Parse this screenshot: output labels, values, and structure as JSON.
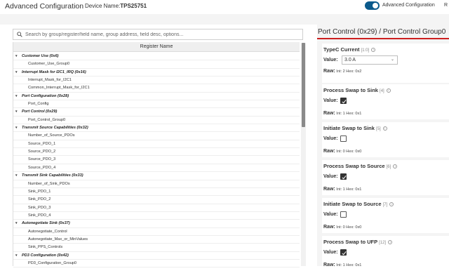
{
  "header": {
    "title": "Advanced Configuration",
    "device_label": "Device Name:",
    "device_name": "TPS25751",
    "toggle_label": "Advanced Configuration",
    "cut_text": "R"
  },
  "search": {
    "placeholder": "Search by group/register/field name, group address, field desc, options..."
  },
  "tree": {
    "header": "Register Name",
    "rows": [
      {
        "type": "group",
        "label": "Customer Use (0x6)"
      },
      {
        "type": "item",
        "label": "Customer_Use_Group0"
      },
      {
        "type": "group",
        "label": "Interrupt Mask for I2C1_IRQ (0x16)"
      },
      {
        "type": "item",
        "label": "Interrupt_Mask_for_I2C1"
      },
      {
        "type": "item",
        "label": "Common_Interrupt_Mask_for_I2C1"
      },
      {
        "type": "group",
        "label": "Port Configuration (0x28)"
      },
      {
        "type": "item",
        "label": "Port_Config"
      },
      {
        "type": "group",
        "label": "Port Control (0x29)"
      },
      {
        "type": "item",
        "label": "Port_Control_Group0"
      },
      {
        "type": "group",
        "label": "Transmit Source Capabilities (0x32)"
      },
      {
        "type": "item",
        "label": "Number_of_Source_PDOs"
      },
      {
        "type": "item",
        "label": "Source_PDO_1"
      },
      {
        "type": "item",
        "label": "Source_PDO_2"
      },
      {
        "type": "item",
        "label": "Source_PDO_3"
      },
      {
        "type": "item",
        "label": "Source_PDO_4"
      },
      {
        "type": "group",
        "label": "Transmit Sink Capabilities (0x33)"
      },
      {
        "type": "item",
        "label": "Number_of_Sink_PDOs"
      },
      {
        "type": "item",
        "label": "Sink_PDO_1"
      },
      {
        "type": "item",
        "label": "Sink_PDO_2"
      },
      {
        "type": "item",
        "label": "Sink_PDO_3"
      },
      {
        "type": "item",
        "label": "Sink_PDO_4"
      },
      {
        "type": "group",
        "label": "Autonegotiate Sink (0x37)"
      },
      {
        "type": "item",
        "label": "Autonegotiate_Control"
      },
      {
        "type": "item",
        "label": "Autonegotiate_Max_or_MinValues"
      },
      {
        "type": "item",
        "label": "Sink_PPS_Controls"
      },
      {
        "type": "group",
        "label": "PD3 Configuration (0x42)"
      },
      {
        "type": "item",
        "label": "PD3_Configuration_Group0"
      }
    ]
  },
  "panel": {
    "title": "Port Control (0x29) / Port Control Group0",
    "typec": {
      "title": "TypeC Current",
      "bits": "[1:0]",
      "value_label": "Value:",
      "value": "3.0 A",
      "raw_label": "Raw:",
      "raw": "Int: 2 Hex: 0x2"
    },
    "fields": [
      {
        "title": "Process Swap to Sink",
        "bits": "[4]",
        "checked": true,
        "raw": "Int: 1 Hex: 0x1"
      },
      {
        "title": "Initiate Swap to Sink",
        "bits": "[5]",
        "checked": false,
        "raw": "Int: 0 Hex: 0x0"
      },
      {
        "title": "Process Swap to Source",
        "bits": "[6]",
        "checked": true,
        "raw": "Int: 1 Hex: 0x1"
      },
      {
        "title": "Initiate Swap to Source",
        "bits": "[7]",
        "checked": false,
        "raw": "Int: 0 Hex: 0x0"
      },
      {
        "title": "Process Swap to UFP",
        "bits": "[12]",
        "checked": true,
        "raw": "Int: 1 Hex: 0x1"
      }
    ],
    "value_label": "Value:",
    "raw_label": "Raw:"
  },
  "colors": {
    "accent": "#0b5a8c",
    "title_underline": "#cc1f1f"
  }
}
